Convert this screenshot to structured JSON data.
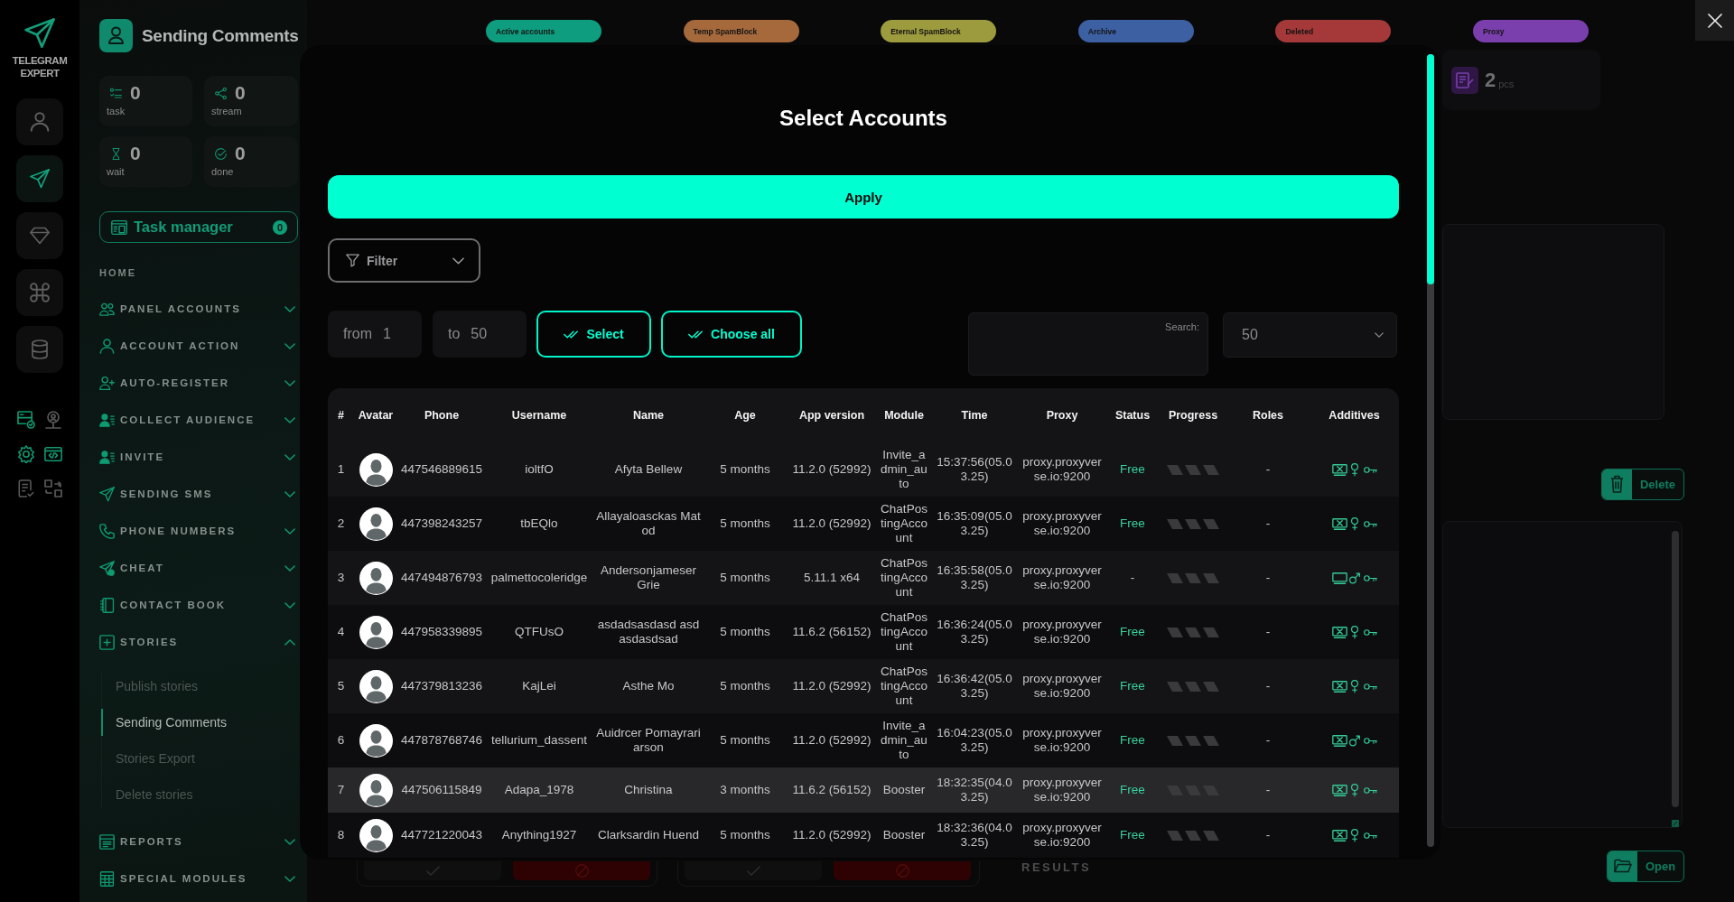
{
  "rail": {
    "logo": "TELEGRAM EXPERT",
    "buttons": [
      {
        "selected": false
      },
      {
        "selected": true
      },
      {
        "selected": false
      },
      {
        "selected": false
      },
      {
        "selected": false
      }
    ]
  },
  "sidebar": {
    "title": "Sending Comments",
    "stats": [
      {
        "value": "0",
        "label": "task"
      },
      {
        "value": "0",
        "label": "stream"
      },
      {
        "value": "0",
        "label": "wait"
      },
      {
        "value": "0",
        "label": "done"
      }
    ],
    "task_manager": {
      "label": "Task manager",
      "count": "0"
    },
    "section": "HOME",
    "menu": [
      {
        "label": "PANEL ACCOUNTS",
        "expanded": false
      },
      {
        "label": "ACCOUNT ACTION",
        "expanded": false
      },
      {
        "label": "AUTO-REGISTER",
        "expanded": false
      },
      {
        "label": "COLLECT AUDIENCE",
        "expanded": false
      },
      {
        "label": "INVITE",
        "expanded": false
      },
      {
        "label": "SENDING SMS",
        "expanded": false
      },
      {
        "label": "PHONE NUMBERS",
        "expanded": false
      },
      {
        "label": "CHEAT",
        "expanded": false
      },
      {
        "label": "CONTACT BOOK",
        "expanded": false
      },
      {
        "label": "STORIES",
        "expanded": true,
        "children": [
          {
            "label": "Publish stories",
            "selected": false
          },
          {
            "label": "Sending Comments",
            "selected": true
          },
          {
            "label": "Stories Export",
            "selected": false
          },
          {
            "label": "Delete stories",
            "selected": false
          }
        ]
      },
      {
        "label": "REPORTS",
        "expanded": false
      },
      {
        "label": "SPECIAL MODULES",
        "expanded": false
      }
    ]
  },
  "status_tabs": [
    {
      "label": "Active accounts",
      "color": "#0e9d7e"
    },
    {
      "label": "Temp SpamBlock",
      "color": "#a5693c"
    },
    {
      "label": "Eternal SpamBlock",
      "color": "#9c9b3e"
    },
    {
      "label": "Archive",
      "color": "#3d60a3"
    },
    {
      "label": "Deleted",
      "color": "#a53838"
    },
    {
      "label": "Proxy",
      "color": "#7a3fac"
    }
  ],
  "background": {
    "counter": {
      "value": "2",
      "unit": "pcs"
    },
    "delete_button": "Delete",
    "open_button": "Open",
    "results_label": "RESULTS"
  },
  "modal": {
    "title": "Select Accounts",
    "apply": "Apply",
    "filter": "Filter",
    "range": {
      "from_label": "from",
      "from_value": "1",
      "to_label": "to",
      "to_value": "50"
    },
    "select": "Select",
    "choose_all": "Choose all",
    "search": {
      "label": "Search:"
    },
    "page_size": "50",
    "table": {
      "columns": [
        "#",
        "Avatar",
        "Phone",
        "Username",
        "Name",
        "Age",
        "App version",
        "Module",
        "Time",
        "Proxy",
        "Status",
        "Progress",
        "Roles",
        "Additives"
      ],
      "rows": [
        {
          "number": "1",
          "phone": "447546889615",
          "username": "ioltfO",
          "name": "Afyta Bellew",
          "age": "5 months",
          "app_version": "11.2.0 (52992)",
          "module": "Invite_admin_auto",
          "time": "15:37:56(05.03.25)",
          "proxy": "proxy.proxyverse.io:9200",
          "status": {
            "text": "Free",
            "kind": "free"
          },
          "roles": "-",
          "additives": [
            {
              "kind": "crossed-screen"
            },
            {
              "kind": "female"
            },
            {
              "kind": "key"
            }
          ],
          "highlighted": false
        },
        {
          "number": "2",
          "phone": "447398243257",
          "username": "tbEQlo",
          "name": "Allayaloasckas Matod",
          "age": "5 months",
          "app_version": "11.2.0 (52992)",
          "module": "ChatPostingAccount",
          "time": "16:35:09(05.03.25)",
          "proxy": "proxy.proxyverse.io:9200",
          "status": {
            "text": "Free",
            "kind": "free"
          },
          "roles": "-",
          "additives": [
            {
              "kind": "crossed-screen"
            },
            {
              "kind": "female"
            },
            {
              "kind": "key"
            }
          ],
          "highlighted": false
        },
        {
          "number": "3",
          "phone": "447494876793",
          "username": "palmettocoleridge",
          "name": "Andersonjameser Grie",
          "age": "5 months",
          "app_version": "5.11.1 x64",
          "module": "ChatPostingAccount",
          "time": "16:35:58(05.03.25)",
          "proxy": "proxy.proxyverse.io:9200",
          "status": {
            "text": "-",
            "kind": "none"
          },
          "roles": "-",
          "additives": [
            {
              "kind": "screen"
            },
            {
              "kind": "male"
            },
            {
              "kind": "key"
            }
          ],
          "highlighted": false
        },
        {
          "number": "4",
          "phone": "447958339895",
          "username": "QTFUsO",
          "name": "asdadsasdasd asdasdasdsad",
          "age": "5 months",
          "app_version": "11.6.2 (56152)",
          "module": "ChatPostingAccount",
          "time": "16:36:24(05.03.25)",
          "proxy": "proxy.proxyverse.io:9200",
          "status": {
            "text": "Free",
            "kind": "free"
          },
          "roles": "-",
          "additives": [
            {
              "kind": "crossed-screen"
            },
            {
              "kind": "female"
            },
            {
              "kind": "key"
            }
          ],
          "highlighted": false
        },
        {
          "number": "5",
          "phone": "447379813236",
          "username": "KajLei",
          "name": "Asthe Mo",
          "age": "5 months",
          "app_version": "11.2.0 (52992)",
          "module": "ChatPostingAccount",
          "time": "16:36:42(05.03.25)",
          "proxy": "proxy.proxyverse.io:9200",
          "status": {
            "text": "Free",
            "kind": "free"
          },
          "roles": "-",
          "additives": [
            {
              "kind": "crossed-screen"
            },
            {
              "kind": "female"
            },
            {
              "kind": "key"
            }
          ],
          "highlighted": false
        },
        {
          "number": "6",
          "phone": "447878768746",
          "username": "tellurium_dassent",
          "name": "Auidrcer Pomayrariarson",
          "age": "5 months",
          "app_version": "11.2.0 (52992)",
          "module": "Invite_admin_auto",
          "time": "16:04:23(05.03.25)",
          "proxy": "proxy.proxyverse.io:9200",
          "status": {
            "text": "Free",
            "kind": "free"
          },
          "roles": "-",
          "additives": [
            {
              "kind": "crossed-screen"
            },
            {
              "kind": "male"
            },
            {
              "kind": "key"
            }
          ],
          "highlighted": false
        },
        {
          "number": "7",
          "phone": "447506115849",
          "username": "Adapa_1978",
          "name": "Christina",
          "age": "3 months",
          "app_version": "11.6.2 (56152)",
          "module": "Booster",
          "time": "18:32:35(04.03.25)",
          "proxy": "proxy.proxyverse.io:9200",
          "status": {
            "text": "Free",
            "kind": "free"
          },
          "roles": "-",
          "additives": [
            {
              "kind": "crossed-screen"
            },
            {
              "kind": "female"
            },
            {
              "kind": "key"
            }
          ],
          "highlighted": true
        },
        {
          "number": "8",
          "phone": "447721220043",
          "username": "Anything1927",
          "name": "Clarksardin Huend",
          "age": "5 months",
          "app_version": "11.2.0 (52992)",
          "module": "Booster",
          "time": "18:32:36(04.03.25)",
          "proxy": "proxy.proxyverse.io:9200",
          "status": {
            "text": "Free",
            "kind": "free"
          },
          "roles": "-",
          "additives": [
            {
              "kind": "crossed-screen"
            },
            {
              "kind": "female"
            },
            {
              "kind": "key"
            }
          ],
          "highlighted": false
        }
      ]
    }
  }
}
